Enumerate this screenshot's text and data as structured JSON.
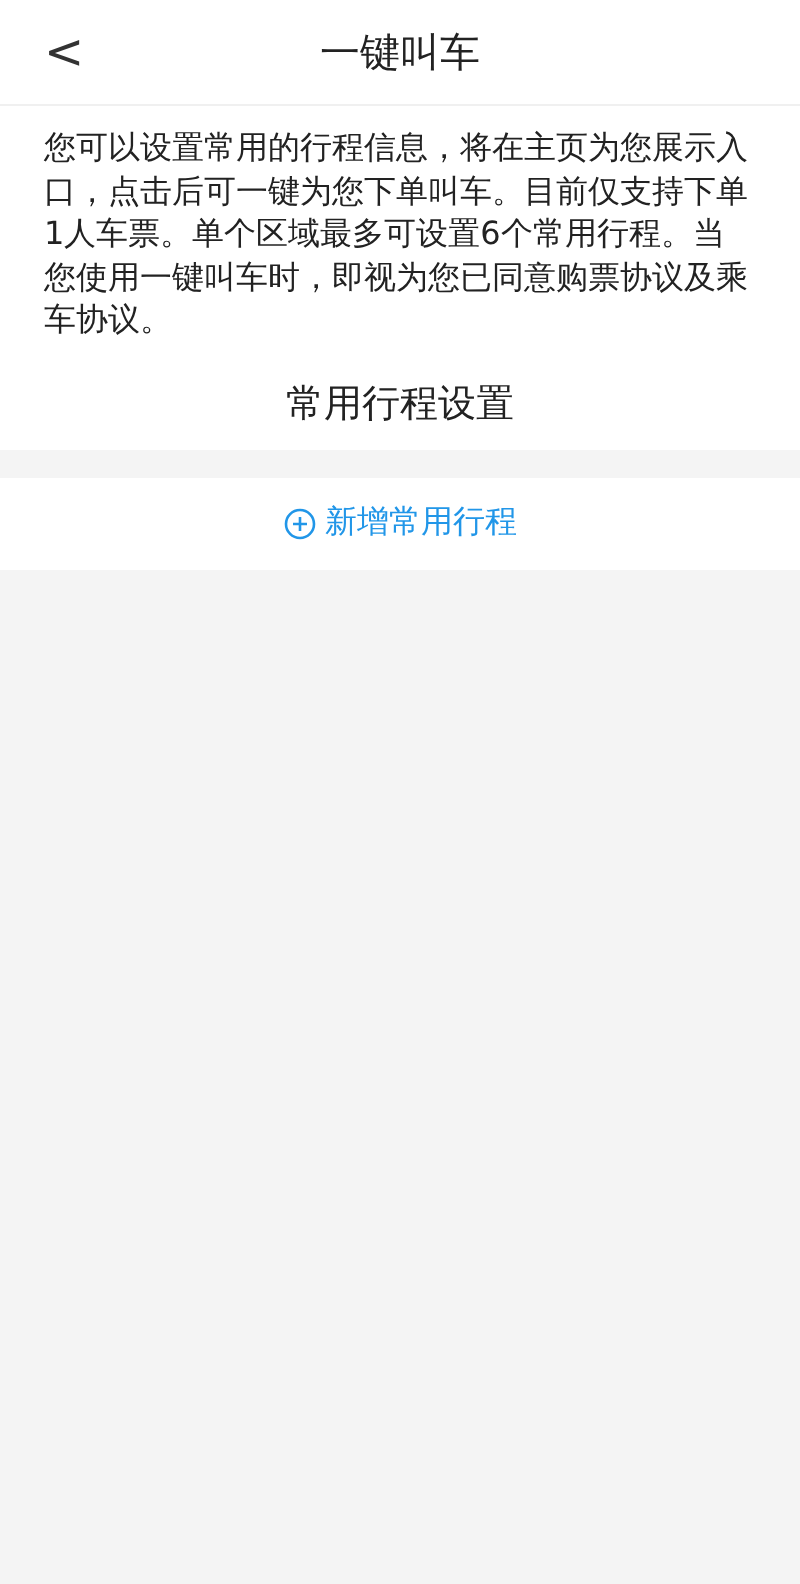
{
  "header": {
    "back": "<",
    "title": "一键叫车"
  },
  "description": "您可以设置常用的行程信息，将在主页为您展示入口，点击后可一键为您下单叫车。目前仅支持下单1人车票。单个区域最多可设置6个常用行程。当您使用一键叫车时，即视为您已同意购票协议及乘车协议。",
  "section_title": "常用行程设置",
  "add_button": {
    "label": "新增常用行程"
  }
}
